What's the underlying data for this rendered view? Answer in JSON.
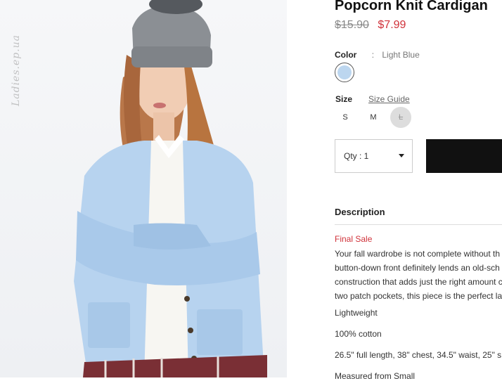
{
  "product": {
    "title": "Popcorn Knit Cardigan",
    "old_price": "$15.90",
    "sale_price": "$7.99"
  },
  "watermark": "Ladies.ep.ua",
  "color": {
    "label": "Color",
    "separator": ":",
    "value": "Light Blue",
    "swatch_color": "#bcd6ef"
  },
  "size": {
    "label": "Size",
    "guide_label": "Size Guide",
    "options": [
      "S",
      "M",
      "L"
    ],
    "unavailable": "L"
  },
  "quantity": {
    "label": "Qty : 1"
  },
  "add_to_bag": {
    "color": "#111111"
  },
  "description": {
    "title": "Description",
    "final_sale": "Final Sale",
    "lines": [
      "Your fall wardrobe is not complete without th",
      "button-down front definitely lends an old-sch",
      "construction that adds just the right amount c",
      "two patch pockets, this piece is the perfect la"
    ],
    "features": [
      "Lightweight",
      "100% cotton",
      "26.5\" full length, 38\" chest, 34.5\" waist, 25\" s",
      "Measured from Small"
    ]
  },
  "colors": {
    "sale": "#d0323a",
    "muted": "#888888"
  }
}
